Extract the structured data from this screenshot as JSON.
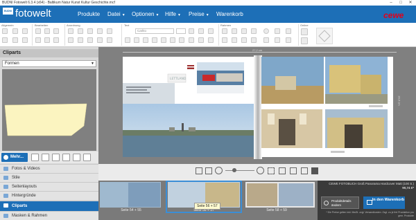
{
  "window": {
    "title": "BUDNI Fotowelt 6.3.4 (x64) - Baltikum Natur Kunst Kultur Geschichte.mcf"
  },
  "brand": {
    "badge": "BUDNI",
    "name": "fotowelt",
    "partner": "cewe",
    "accent": "#1d6fb7"
  },
  "menu": [
    {
      "label": "Produkte"
    },
    {
      "label": "Datei"
    },
    {
      "label": "Optionen"
    },
    {
      "label": "Hilfe"
    },
    {
      "label": "Preise"
    },
    {
      "label": "Warenkorb"
    }
  ],
  "ribbon": {
    "groups": [
      "Allgemein",
      "Bearbeiten",
      "Anordnung",
      "Text",
      "Rahmen",
      "Online"
    ],
    "font": "Carlito"
  },
  "sidebar": {
    "header": "Cliparts",
    "category": "Formen",
    "more_button": "Mehr...",
    "nav": [
      {
        "label": "Fotos & Videos"
      },
      {
        "label": "Stile"
      },
      {
        "label": "Seitenlayouts"
      },
      {
        "label": "Hintergründe"
      },
      {
        "label": "Cliparts",
        "active": true
      },
      {
        "label": "Masken & Rahmen"
      }
    ]
  },
  "canvas": {
    "ruler_top": "27,2 cm",
    "ruler_side": "20,5 cm",
    "page_text": "Seite 56",
    "stamp_text": "LETTLAND"
  },
  "thumbnails": [
    {
      "label": "Seite 54 + 55"
    },
    {
      "label": "Seite 56 + 57",
      "tooltip": "Seite 56 + 57"
    },
    {
      "label": "Seite 58 + 59"
    }
  ],
  "product": {
    "name": "CEWE FOTOBUCH Groß Panorama Hardcover Matt (100 S.)",
    "price": "90,74 €*",
    "details_button": "Produktdetails ändern",
    "cart_button": "In den Warenkorb",
    "note": "* Die Preise gelten inkl. MwSt. zzgl. Versandkosten. Zzgl. zu je frei Produktion pro gem. Produkte"
  }
}
